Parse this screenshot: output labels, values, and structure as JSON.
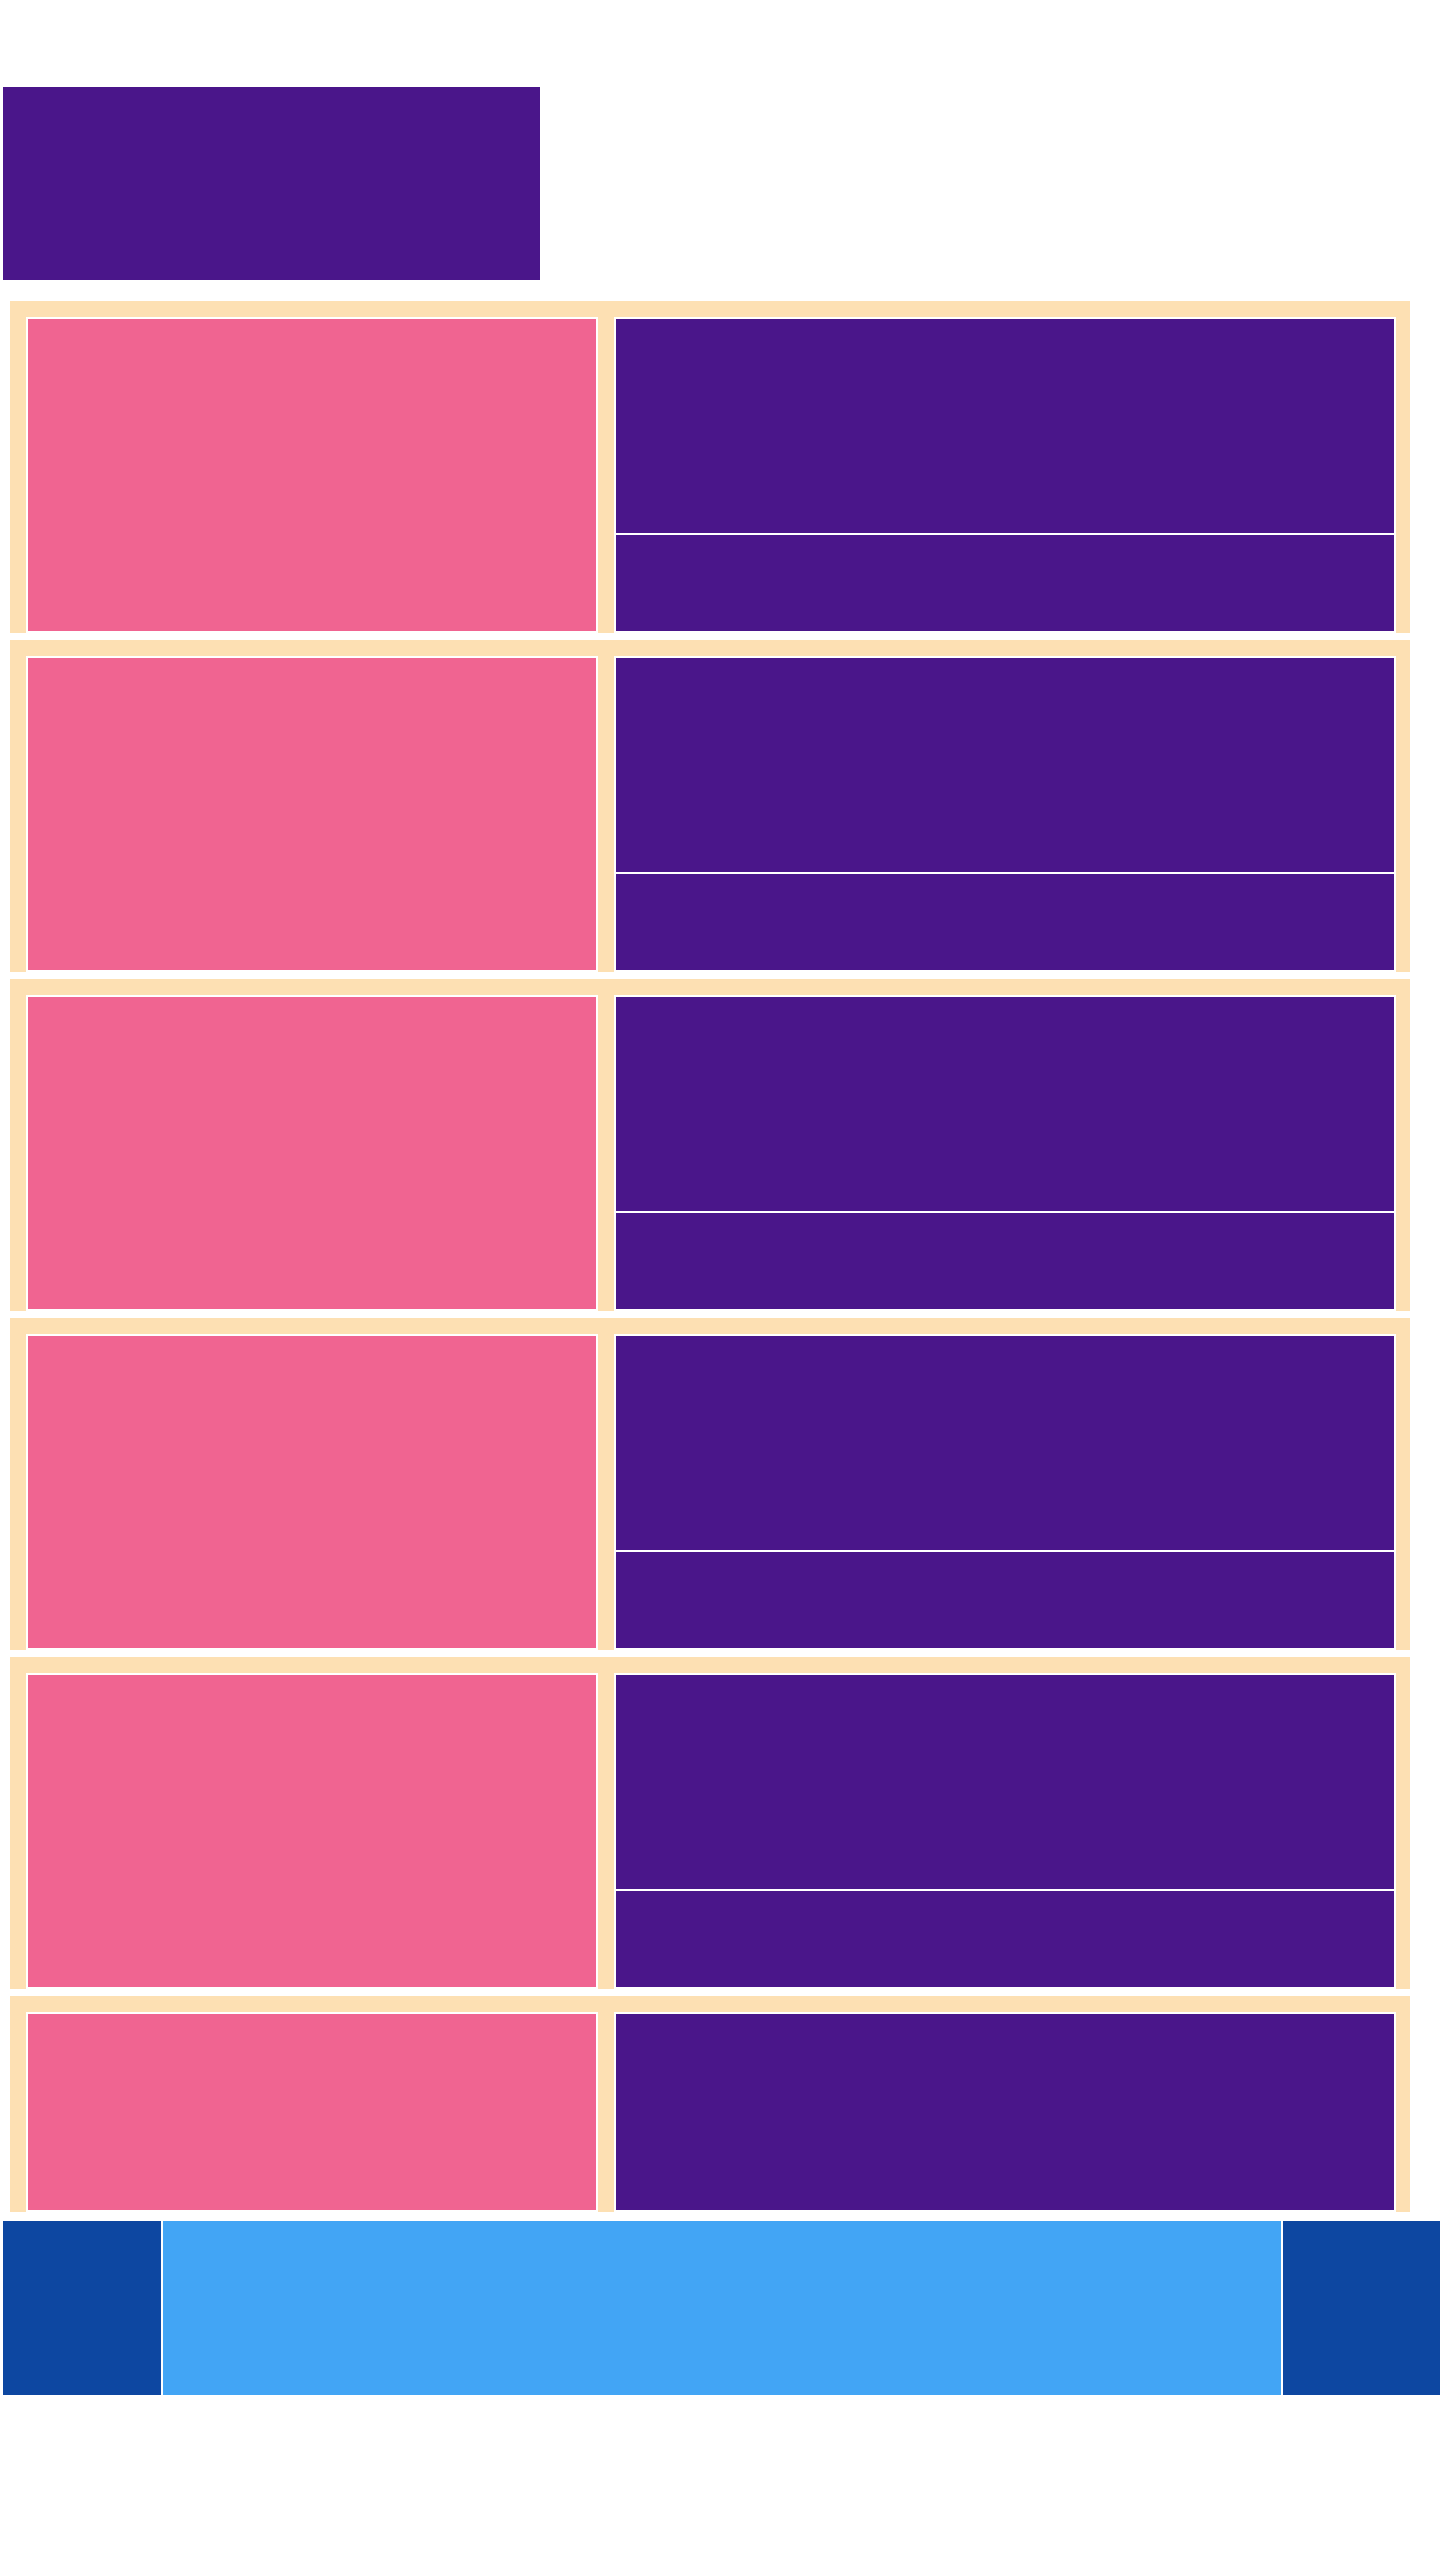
{
  "theme": {
    "header_color": "#4a168a",
    "row_background": "#fde0b3",
    "row_image_color": "#f06491",
    "row_text_block_color": "#4a168a",
    "footer_side_color": "#0d47a1",
    "footer_center_color": "#42a5f5"
  },
  "header": {
    "title": ""
  },
  "list": {
    "rows": [
      {
        "title": "",
        "subtitle": ""
      },
      {
        "title": "",
        "subtitle": ""
      },
      {
        "title": "",
        "subtitle": ""
      },
      {
        "title": "",
        "subtitle": ""
      },
      {
        "title": "",
        "subtitle": ""
      },
      {
        "title": "",
        "subtitle": ""
      }
    ]
  },
  "footer": {
    "left": "",
    "center": "",
    "right": ""
  }
}
